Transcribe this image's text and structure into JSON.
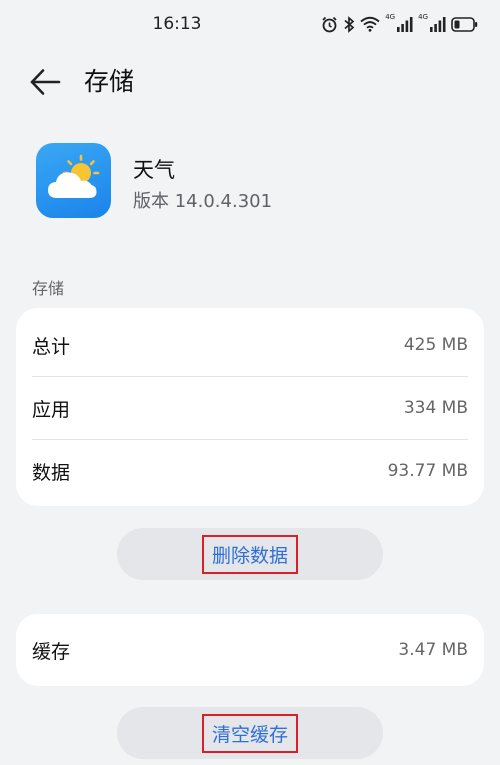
{
  "status_bar": {
    "time": "16:13",
    "network_tag_1": "4G",
    "network_tag_2": "4G",
    "icons": [
      "alarm-icon",
      "bluetooth-icon",
      "wifi-icon",
      "signal-icon",
      "signal-icon",
      "battery-icon"
    ]
  },
  "app_bar": {
    "title": "存储",
    "back_icon": "arrow-left-icon"
  },
  "app": {
    "name": "天气",
    "version": "版本 14.0.4.301",
    "icon": "weather-app-icon"
  },
  "storage_section": {
    "label": "存储",
    "rows": [
      {
        "label": "总计",
        "value": "425 MB"
      },
      {
        "label": "应用",
        "value": "334 MB"
      },
      {
        "label": "数据",
        "value": "93.77 MB"
      }
    ]
  },
  "actions": {
    "delete_data": "删除数据",
    "clear_cache": "清空缓存"
  },
  "cache_section": {
    "label": "缓存",
    "value": "3.47 MB"
  },
  "colors": {
    "background": "#f1f3f5",
    "card": "#ffffff",
    "accent": "#2f6fd8",
    "highlight_box": "#d8202a"
  }
}
